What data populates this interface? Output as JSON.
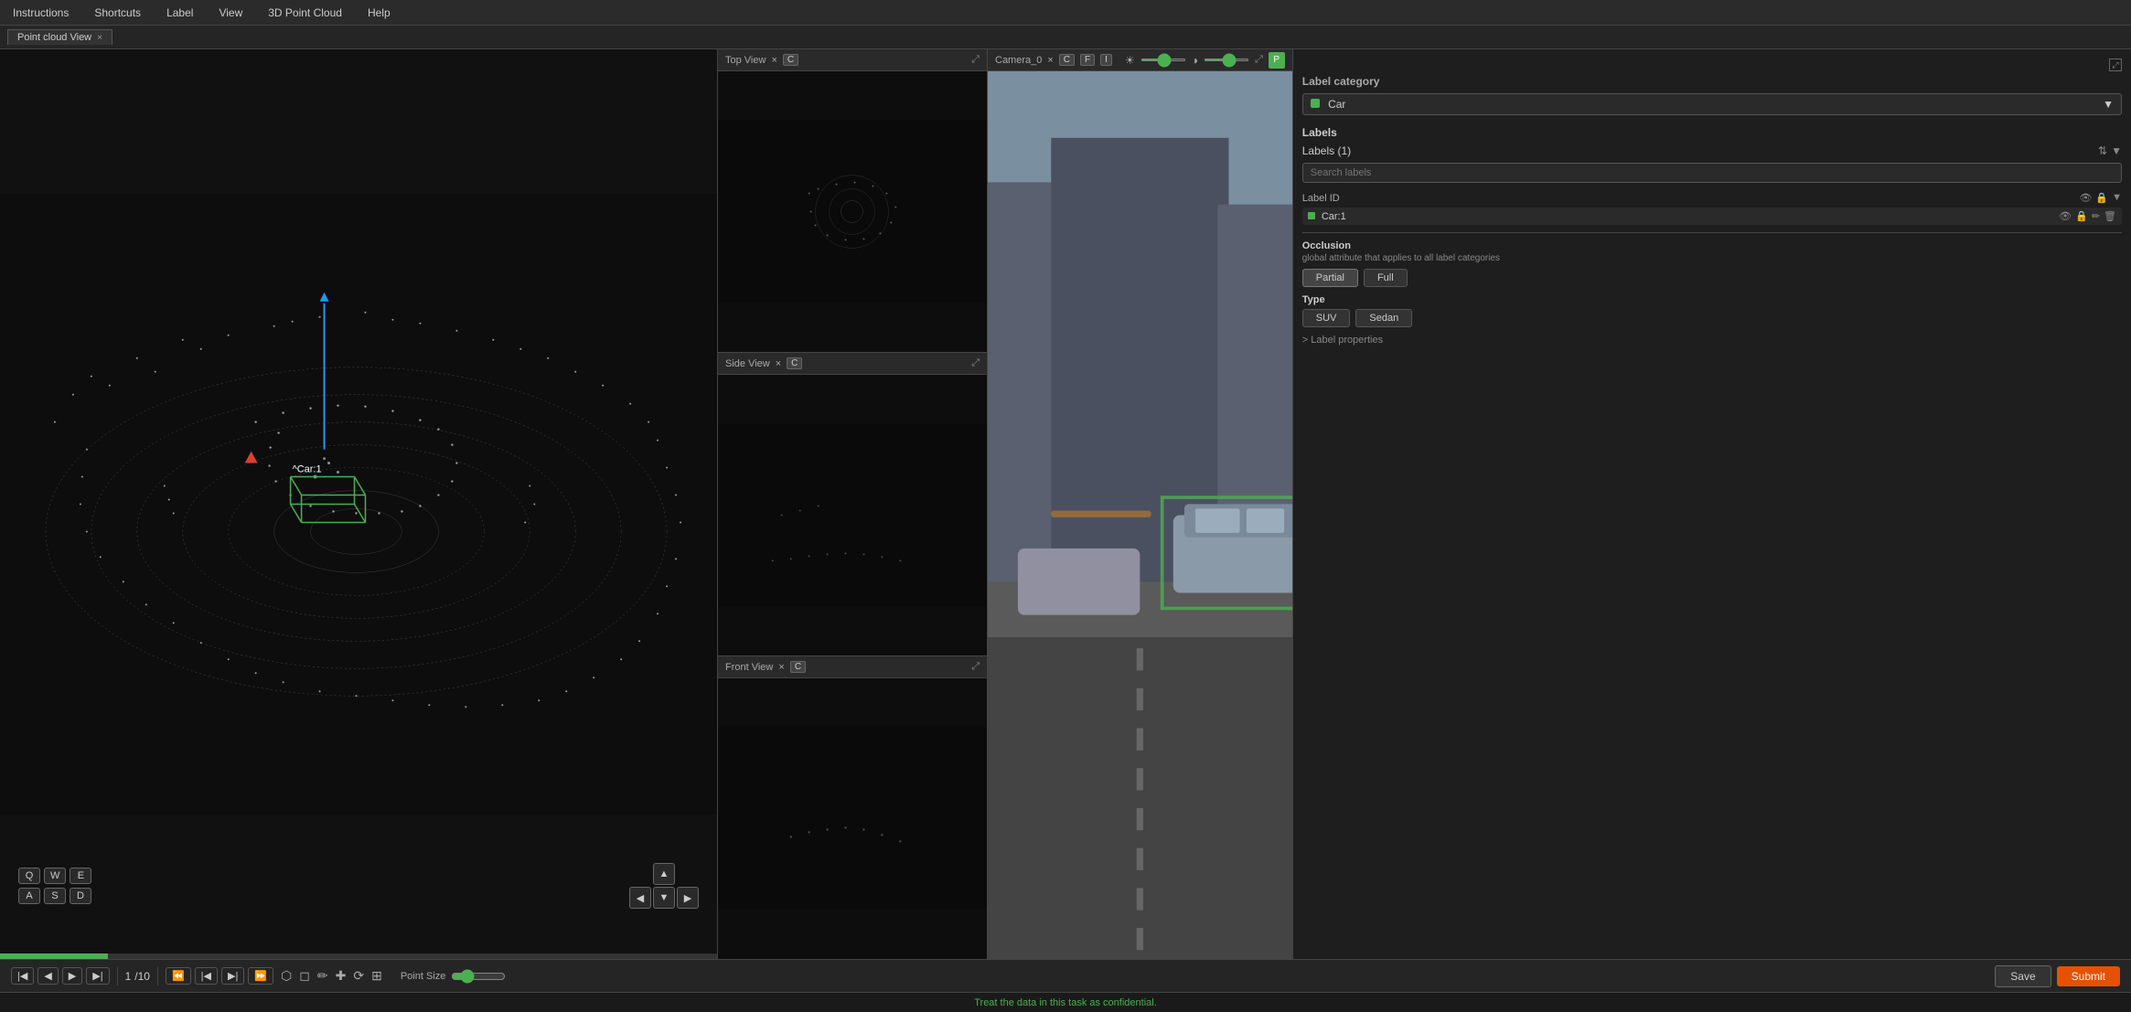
{
  "menu": {
    "items": [
      "Instructions",
      "Shortcuts",
      "Label",
      "View",
      "3D Point Cloud",
      "Help"
    ]
  },
  "tabs": {
    "pointCloud": "Point cloud View",
    "topView": "Top View",
    "sideView": "Side View",
    "frontView": "Front View",
    "camera": "Camera_0"
  },
  "topView": {
    "title": "Top View",
    "closeBtn": "×",
    "cBtn": "C",
    "expandBtn": "⤢"
  },
  "sideView": {
    "title": "Side View",
    "closeBtn": "×",
    "cBtn": "C",
    "expandBtn": "⤢"
  },
  "frontView": {
    "title": "Front View",
    "closeBtn": "×",
    "cBtn": "C",
    "expandBtn": "⤢"
  },
  "camera": {
    "title": "Camera_0",
    "closeBtn": "×",
    "cBtn": "C",
    "fBtn": "F",
    "iBtn": "I",
    "expandBtn": "⤢"
  },
  "labelPanel": {
    "categoryTitle": "Label category",
    "categoryValue": "Car",
    "labelsTitle": "Labels",
    "labelsCount": "Labels (1)",
    "searchPlaceholder": "Search labels",
    "labelIdTitle": "Label ID",
    "carLabel": "Car:1",
    "occlusion": {
      "title": "Occlusion",
      "desc": "global attribute that applies to all label categories",
      "partial": "Partial",
      "full": "Full"
    },
    "type": {
      "title": "Type",
      "suv": "SUV",
      "sedan": "Sedan"
    },
    "labelProperties": "> Label properties"
  },
  "pointCloud": {
    "carLabelText": "^Car:1"
  },
  "keyboard": {
    "row1": [
      "Q",
      "W",
      "E"
    ],
    "row2": [
      "A",
      "S",
      "D"
    ]
  },
  "playback": {
    "frame": "1",
    "totalFrames": "/10"
  },
  "toolbar": {
    "pointSizeLabel": "Point Size",
    "saveLabel": "Save",
    "submitLabel": "Submit"
  },
  "statusBar": {
    "message": "Treat the data in this task as confidential."
  },
  "topBarControls": {
    "pBtn": "P",
    "brightIcon": "☀",
    "contrastIcon": "◑"
  }
}
